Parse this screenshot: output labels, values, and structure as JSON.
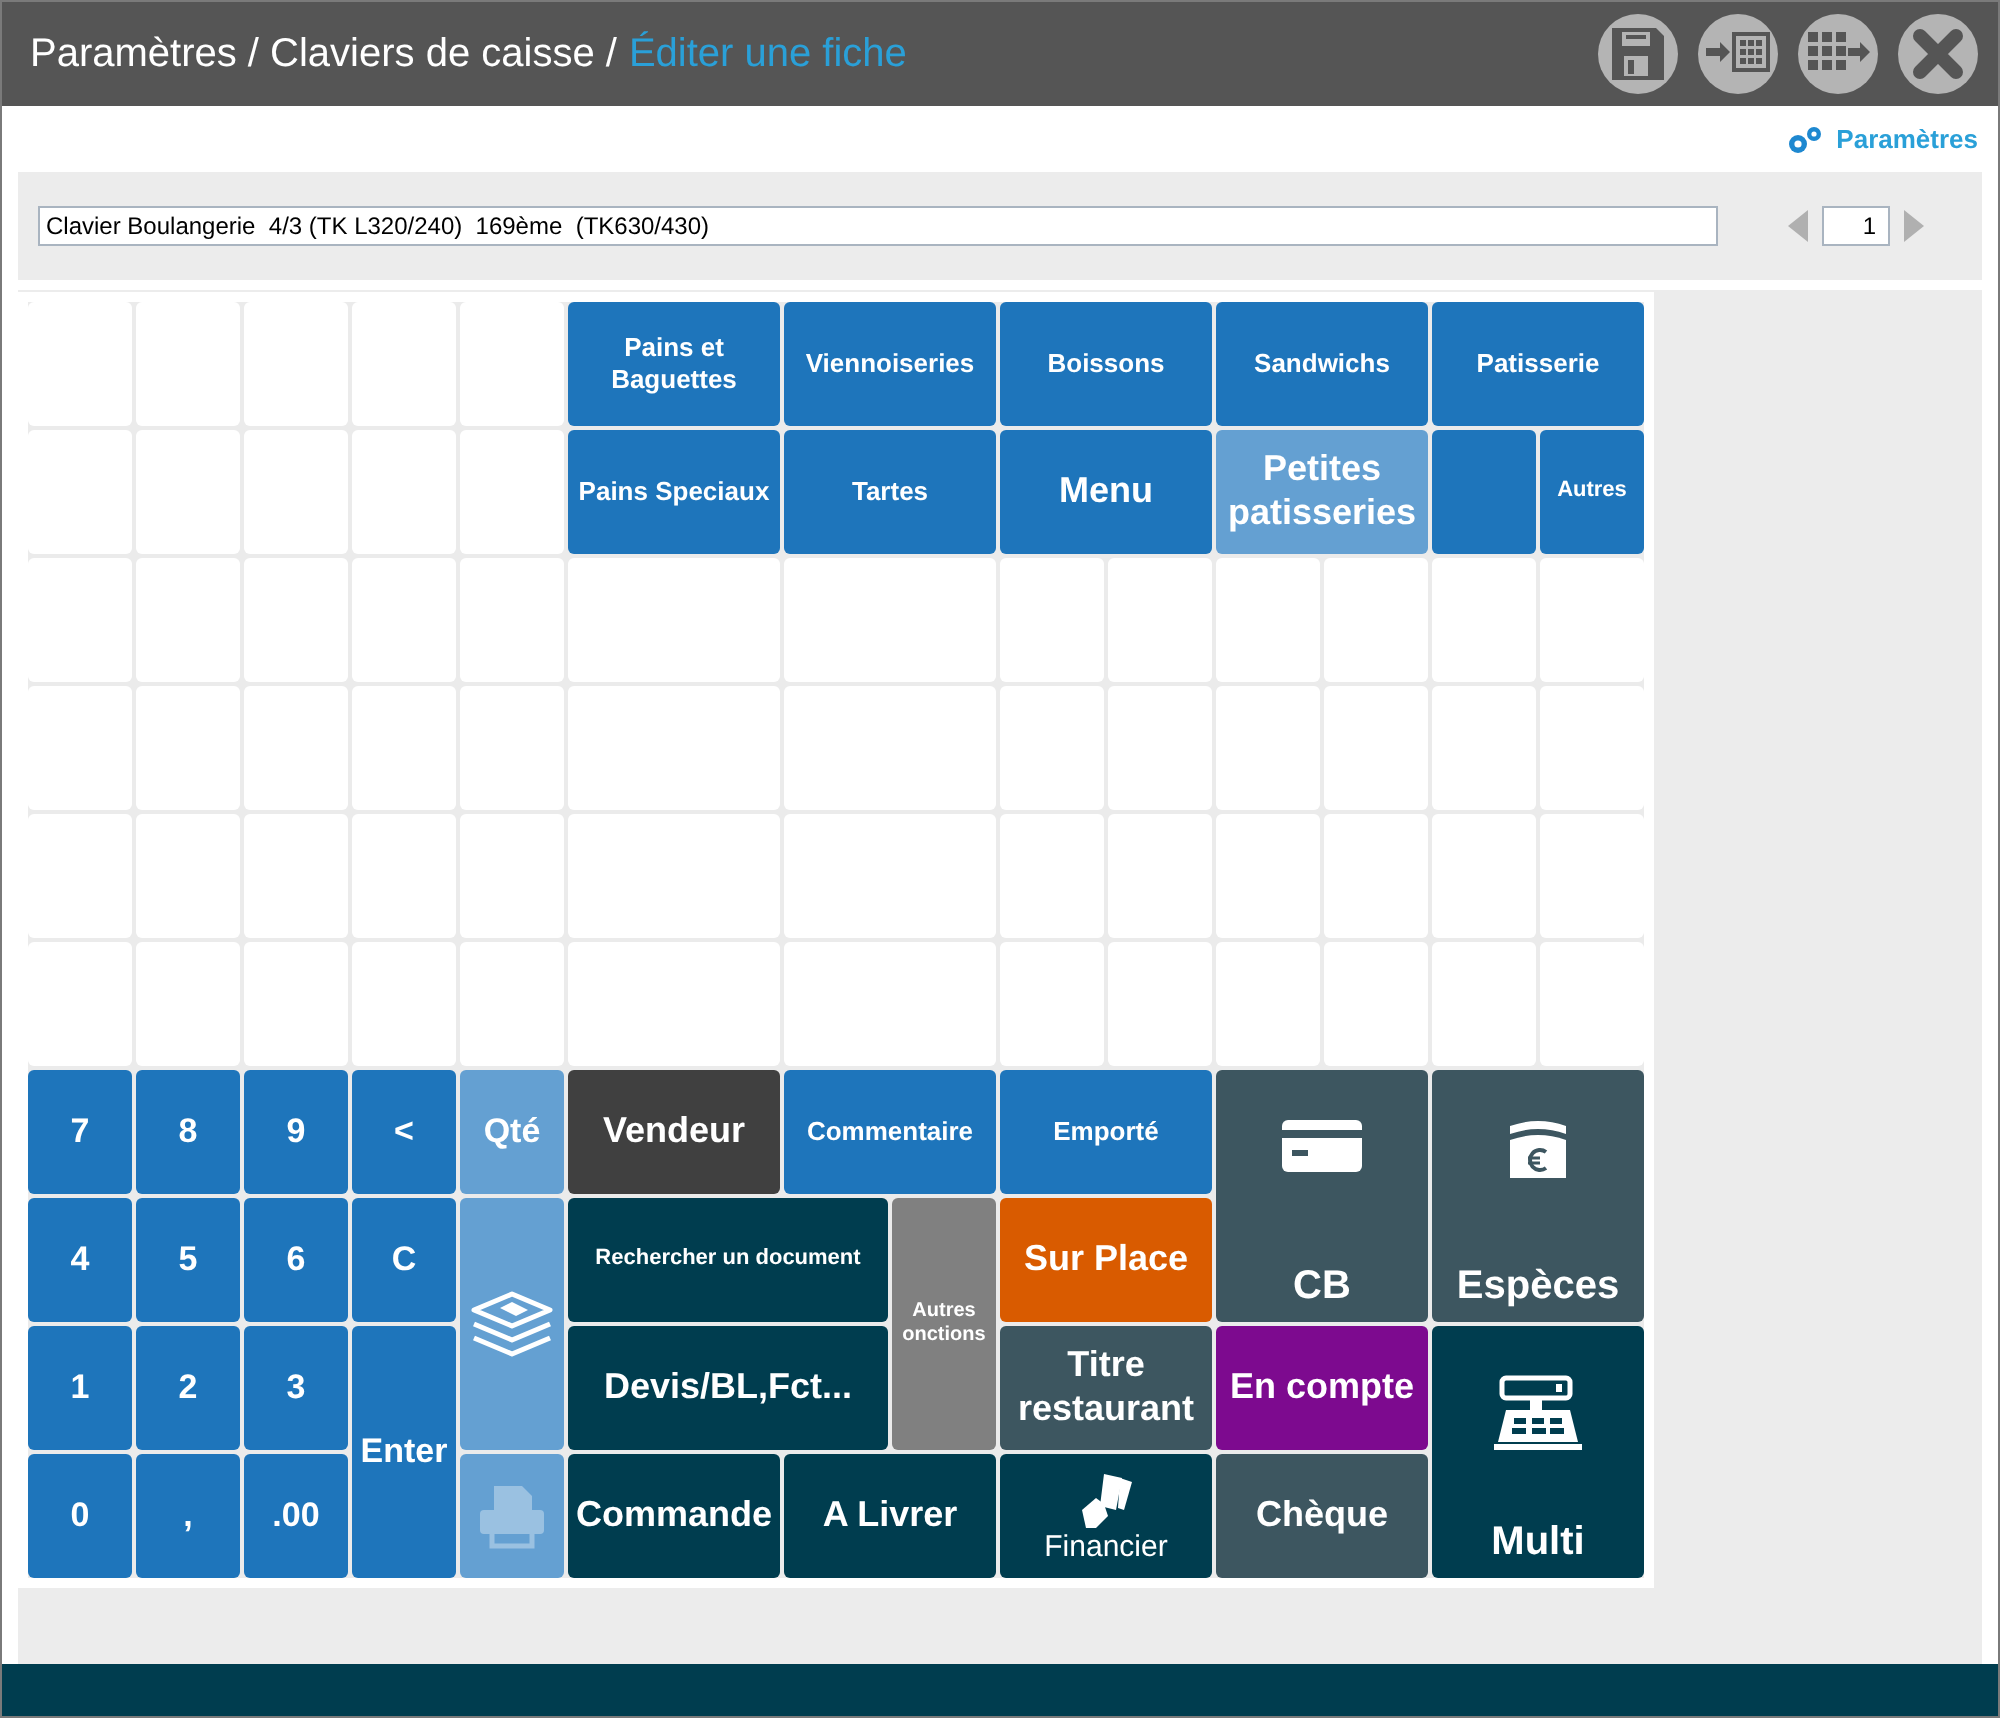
{
  "header": {
    "path": "Paramètres / Claviers de caisse /",
    "current": "Éditer une fiche"
  },
  "settings_link": "Paramètres",
  "keyboard_name": "Clavier Boulangerie  4/3 (TK L320/240)  169ème  (TK630/430)",
  "page": "1",
  "keys": [
    {
      "label": "Pains et Baguettes",
      "kind": "text",
      "color": "#1e75bb",
      "disabled": false
    },
    {
      "label": "Viennoiseries",
      "kind": "text",
      "color": "#1e75bb",
      "disabled": false
    },
    {
      "label": "Boissons",
      "kind": "text",
      "color": "#1e75bb",
      "disabled": false
    },
    {
      "label": "Sandwichs",
      "kind": "text",
      "color": "#1e75bb",
      "disabled": false
    },
    {
      "label": "Patisserie",
      "kind": "text",
      "color": "#1e75bb",
      "disabled": false
    },
    {
      "label": "Pains Speciaux",
      "kind": "text",
      "color": "#1e75bb",
      "disabled": false
    },
    {
      "label": "Tartes",
      "kind": "text",
      "color": "#1e75bb",
      "disabled": false
    },
    {
      "label": "Menu",
      "kind": "text",
      "color": "#1e75bb",
      "disabled": false
    },
    {
      "label": "Petites patisseries",
      "kind": "text",
      "color": "#64a0d2",
      "disabled": false
    },
    {
      "kind": "text",
      "color": "#1e75bb"
    },
    {
      "label": "Autres",
      "kind": "text",
      "color": "#1e75bb",
      "disabled": false
    },
    {
      "label": "7",
      "kind": "text",
      "color": "#1e75bb",
      "disabled": false
    },
    {
      "label": "8",
      "kind": "text",
      "color": "#1e75bb",
      "disabled": false
    },
    {
      "label": "9",
      "kind": "text",
      "color": "#1e75bb",
      "disabled": false
    },
    {
      "label": "<",
      "kind": "text",
      "color": "#1e75bb",
      "disabled": false
    },
    {
      "label": "Qté",
      "kind": "text",
      "color": "#64a0d2",
      "disabled": false
    },
    {
      "label": "Vendeur",
      "kind": "text",
      "color": "#404040",
      "disabled": false
    },
    {
      "label": "Commentaire",
      "kind": "text",
      "color": "#1e75bb",
      "disabled": false
    },
    {
      "label": "Emporté",
      "kind": "text",
      "color": "#1e75bb",
      "disabled": false
    },
    {
      "label": "CB",
      "kind": "card",
      "color": "#3d5660",
      "disabled": false
    },
    {
      "label": "Espèces",
      "kind": "cash",
      "color": "#3d5660",
      "disabled": false
    },
    {
      "label": "4",
      "kind": "text",
      "color": "#1e75bb",
      "disabled": false
    },
    {
      "label": "5",
      "kind": "text",
      "color": "#1e75bb",
      "disabled": false
    },
    {
      "label": "6",
      "kind": "text",
      "color": "#1e75bb",
      "disabled": false
    },
    {
      "label": "C",
      "kind": "text",
      "color": "#1e75bb",
      "disabled": false
    },
    {
      "kind": "layers",
      "color": "#64a0d2",
      "disabled": false
    },
    {
      "label": "Rechercher un document",
      "kind": "text",
      "color": "#003d4f",
      "disabled": false
    },
    {
      "label": "Autres onctions",
      "kind": "text",
      "color": "#808080",
      "disabled": false
    },
    {
      "label": "Sur Place",
      "kind": "text",
      "color": "#d95b00",
      "disabled": false
    },
    {
      "label": "1",
      "kind": "text",
      "color": "#1e75bb",
      "disabled": false
    },
    {
      "label": "2",
      "kind": "text",
      "color": "#1e75bb",
      "disabled": false
    },
    {
      "label": "3",
      "kind": "text",
      "color": "#1e75bb",
      "disabled": false
    },
    {
      "label": "Enter",
      "kind": "text",
      "color": "#1e75bb",
      "disabled": false
    },
    {
      "label": "Devis/BL,Fct...",
      "kind": "text",
      "color": "#003d4f",
      "disabled": false
    },
    {
      "label": "Titre restaurant",
      "kind": "text",
      "color": "#3d5660",
      "disabled": false
    },
    {
      "label": "En compte",
      "kind": "text",
      "color": "#7d0a8f",
      "disabled": false
    },
    {
      "label": "Multi",
      "kind": "register",
      "color": "#003d4f",
      "disabled": false
    },
    {
      "label": "0",
      "kind": "text",
      "color": "#1e75bb",
      "disabled": false
    },
    {
      "label": ",",
      "kind": "text",
      "color": "#1e75bb",
      "disabled": false
    },
    {
      "label": ".00",
      "kind": "text",
      "color": "#1e75bb",
      "disabled": false
    },
    {
      "kind": "printer",
      "color": "#64a0d2",
      "disabled": true
    },
    {
      "label": "Commande",
      "kind": "text",
      "color": "#003d4f",
      "disabled": false
    },
    {
      "label": "A Livrer",
      "kind": "text",
      "color": "#003d4f",
      "disabled": false
    },
    {
      "label": "Financier",
      "kind": "hand",
      "color": "#003d4f",
      "disabled": false
    },
    {
      "label": "Chèque",
      "kind": "text",
      "color": "#3d5660",
      "disabled": false
    }
  ]
}
